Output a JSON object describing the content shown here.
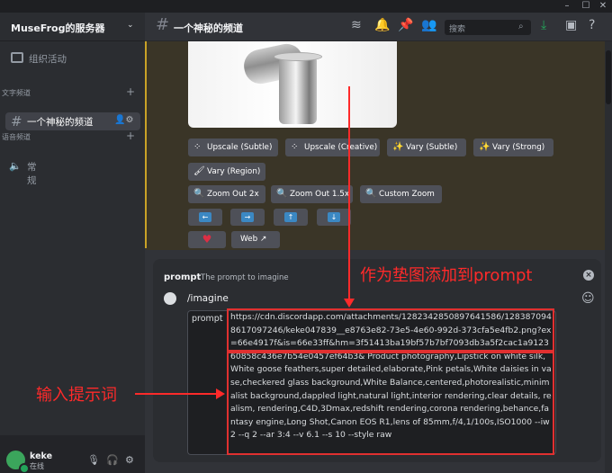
{
  "window": {
    "minimize": "–",
    "maximize": "☐",
    "close": "✕"
  },
  "server": {
    "name": "MuseFrog的服务器",
    "chevron": "⌄"
  },
  "sidebar": {
    "activity_label": "组织活动",
    "text_category": "文字频道",
    "voice_category": "语音频道",
    "active_channel": "一个神秘的频道",
    "voice_channel": "常规"
  },
  "user": {
    "name": "keke",
    "status": "在线"
  },
  "header": {
    "channel_title": "一个神秘的频道",
    "search_placeholder": "搜索"
  },
  "message": {
    "buttons_row1": [
      {
        "label": "Upscale (Subtle)",
        "icon": "⁘"
      },
      {
        "label": "Upscale (Creative)",
        "icon": "⁘"
      },
      {
        "label": "Vary (Subtle)",
        "icon": "✨"
      },
      {
        "label": "Vary (Strong)",
        "icon": "✨"
      }
    ],
    "vary_region": {
      "label": "Vary (Region)",
      "icon": "🖌"
    },
    "zoom_buttons": [
      {
        "label": "Zoom Out 2x",
        "icon": "🔍"
      },
      {
        "label": "Zoom Out 1.5x",
        "icon": "🔍"
      },
      {
        "label": "Custom Zoom",
        "icon": "🔍"
      }
    ],
    "arrows": [
      "←",
      "→",
      "↑",
      "↓"
    ],
    "heart": "♥",
    "web_label": "Web ↗"
  },
  "composer": {
    "command": "prompt",
    "description": "The prompt to imagine",
    "slash": "/imagine",
    "field_label": "prompt",
    "prompt_value": "https://cdn.discordapp.com/attachments/1282342850897641586/1283870948617097246/keke047839__e8763e82-73e5-4e60-992d-373cfa5e4fb2.png?ex=66e4917f&is=66e33ff&hm=3f51413ba19bf57b7bf7093db3a5f2cac1a912360858c436e7b54e0457ef64b3& Product photography,Lipstick on white silk,White goose feathers,super detailed,elaborate,Pink petals,White daisies in vase,checkered glass background,White Balance,centered,photorealistic,minimalist background,dappled light,natural light,interior rendering,clear details, realism, rendering,C4D,3Dmax,redshift rendering,corona rendering,behance,fantasy engine,Long Shot,Canon EOS R1,lens of 85mm,f/4,1/100s,ISO1000 --iw 2 --q 2 --ar 3:4 --v 6.1 --s 10 --style raw"
  },
  "annotations": {
    "top": "作为垫图添加到prompt",
    "left": "输入提示词"
  },
  "colors": {
    "annotation_red": "#ff2a2a",
    "accent_bar": "#c9a227",
    "button_bg": "#4e5058"
  }
}
